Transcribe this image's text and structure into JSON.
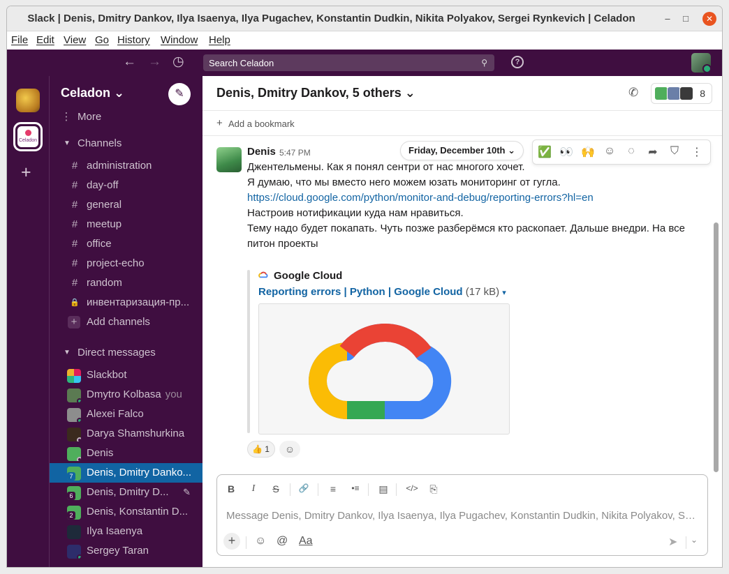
{
  "window": {
    "title": "Slack | Denis, Dmitry Dankov, Ilya Isaenya, Ilya Pugachev, Konstantin Dudkin, Nikita Polyakov, Sergei Rynkevich | Celadon",
    "controls": {
      "minimize": "–",
      "maximize": "□",
      "close": "✕"
    }
  },
  "menubar": [
    "File",
    "Edit",
    "View",
    "Go",
    "History",
    "Window",
    "Help"
  ],
  "topbar": {
    "back_icon": "←",
    "forward_icon": "→",
    "history_icon": "◷",
    "search_placeholder": "Search Celadon",
    "search_icon": "⚲",
    "help_icon": "?"
  },
  "rail": {
    "add_icon": "+",
    "workspace_label": "Celadon"
  },
  "sidebar": {
    "workspace": "Celadon ⌄",
    "compose_icon": "✎",
    "more": {
      "icon": "⋮",
      "label": "More"
    },
    "channels_header": "Channels",
    "channels": [
      {
        "icon": "#",
        "label": "administration"
      },
      {
        "icon": "#",
        "label": "day-off"
      },
      {
        "icon": "#",
        "label": "general"
      },
      {
        "icon": "#",
        "label": "meetup"
      },
      {
        "icon": "#",
        "label": "office"
      },
      {
        "icon": "#",
        "label": "project-echo"
      },
      {
        "icon": "#",
        "label": "random"
      },
      {
        "icon": "🔒",
        "label": "инвентаризация-пр..."
      }
    ],
    "add_channels": {
      "icon": "+",
      "label": "Add channels"
    },
    "dm_header": "Direct messages",
    "dms": [
      {
        "label": "Slackbot",
        "avatar_color": "#e01e5a"
      },
      {
        "label": "Dmytro Kolbasa",
        "suffix": "you",
        "avatar_color": "#5b7a52"
      },
      {
        "label": "Alexei Falco",
        "avatar_color": "#8d8d8d"
      },
      {
        "label": "Darya Shamshurkina",
        "avatar_color": "#3b2a1e"
      },
      {
        "label": "Denis",
        "avatar_color": "#4fae5c"
      },
      {
        "label": "Denis, Dmitry Danko...",
        "count": "7",
        "avatar_color": "#4fae5c",
        "active": true
      },
      {
        "label": "Denis, Dmitry D...",
        "count": "6",
        "avatar_color": "#4fae5c",
        "edit_icon": "✎"
      },
      {
        "label": "Denis, Konstantin D...",
        "count": "2",
        "avatar_color": "#4fae5c"
      },
      {
        "label": "Ilya Isaenya",
        "avatar_color": "#1e2a3a"
      },
      {
        "label": "Sergey Taran",
        "avatar_color": "#2d2d6b"
      }
    ]
  },
  "channel": {
    "title": "Denis, Dmitry Dankov, 5 others ⌄",
    "phone_icon": "✆",
    "member_count": "8",
    "bookmark": {
      "icon": "+",
      "label": "Add a bookmark"
    }
  },
  "message": {
    "date": "Friday, December 10th ⌄",
    "hover_actions": [
      "✅",
      "👀",
      "🙌",
      "☺",
      "◌",
      "➦",
      "⛉",
      "⋮"
    ],
    "author": "Denis",
    "time": "5:47 PM",
    "lines": [
      "Джентельмены.  Как я понял сентри от нас многого хочет.",
      "Я думаю, что мы вместо него можем юзать мониторинг от гугла.",
      "https://cloud.google.com/python/monitor-and-debug/reporting-errors?hl=en",
      "Настроив нотификации куда нам нравиться.",
      "Тему надо будет покапать. Чуть позже разберёмся кто раскопает. Дальше внедри. На все",
      "питон проекты"
    ],
    "attachment": {
      "source": "Google Cloud",
      "file_link": "Reporting errors  |  Python  |  Google Cloud",
      "file_size": "(17 kB)",
      "caret": "▾"
    },
    "reaction": {
      "emoji": "👍",
      "count": "1"
    },
    "add_reaction_icon": "☺"
  },
  "composer": {
    "placeholder": "Message Denis, Dmitry Dankov, Ilya Isaenya, Ilya Pugachev, Konstantin Dudkin, Nikita Polyakov, Serg...",
    "format": [
      "B",
      "I",
      "S",
      "🔗",
      "≡",
      "•≡",
      "▤",
      "</>",
      "⎘"
    ],
    "bottom": {
      "plus": "+",
      "emoji": "☺",
      "mention": "@",
      "text_format": "Aa",
      "send": "➤",
      "send_options": "⌄"
    }
  },
  "colors": {
    "aubergine": "#3f0e40",
    "active": "#1164a3",
    "link": "#1264a3",
    "online": "#2bac76"
  }
}
